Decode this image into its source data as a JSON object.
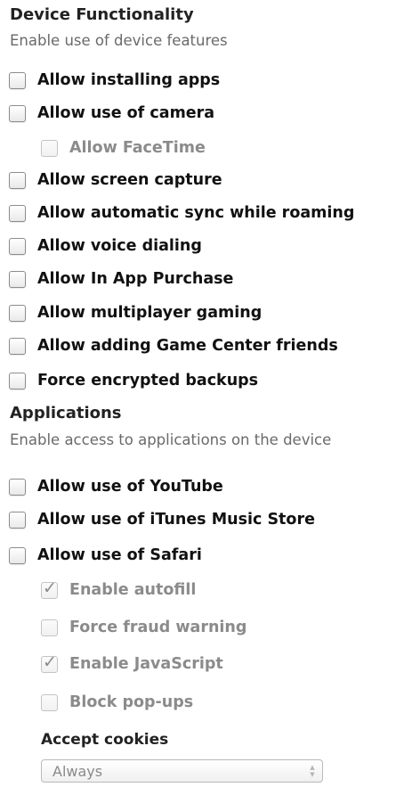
{
  "device_functionality": {
    "title": "Device Functionality",
    "subtitle": "Enable use of device features",
    "items": [
      {
        "label": "Allow installing apps",
        "checked": false,
        "disabled": false
      },
      {
        "label": "Allow use of camera",
        "checked": false,
        "disabled": false
      },
      {
        "label": "Allow FaceTime",
        "checked": false,
        "disabled": true
      },
      {
        "label": "Allow screen capture",
        "checked": false,
        "disabled": false
      },
      {
        "label": "Allow automatic sync while roaming",
        "checked": false,
        "disabled": false
      },
      {
        "label": "Allow voice dialing",
        "checked": false,
        "disabled": false
      },
      {
        "label": "Allow In App Purchase",
        "checked": false,
        "disabled": false
      },
      {
        "label": "Allow multiplayer gaming",
        "checked": false,
        "disabled": false
      },
      {
        "label": "Allow adding Game Center friends",
        "checked": false,
        "disabled": false
      },
      {
        "label": "Force encrypted backups",
        "checked": false,
        "disabled": false
      }
    ]
  },
  "applications": {
    "title": "Applications",
    "subtitle": "Enable access to applications on the device",
    "items": [
      {
        "label": "Allow use of YouTube",
        "checked": false,
        "disabled": false
      },
      {
        "label": "Allow use of iTunes Music Store",
        "checked": false,
        "disabled": false
      },
      {
        "label": "Allow use of Safari",
        "checked": false,
        "disabled": false
      },
      {
        "label": "Enable autofill",
        "checked": true,
        "disabled": true
      },
      {
        "label": "Force fraud warning",
        "checked": false,
        "disabled": true
      },
      {
        "label": "Enable JavaScript",
        "checked": true,
        "disabled": true
      },
      {
        "label": "Block pop-ups",
        "checked": false,
        "disabled": true
      }
    ],
    "cookies": {
      "title": "Accept cookies",
      "selected": "Always"
    }
  },
  "icons": {
    "checkmark": "checkmark-icon",
    "select_arrows": "select-arrows-icon"
  }
}
